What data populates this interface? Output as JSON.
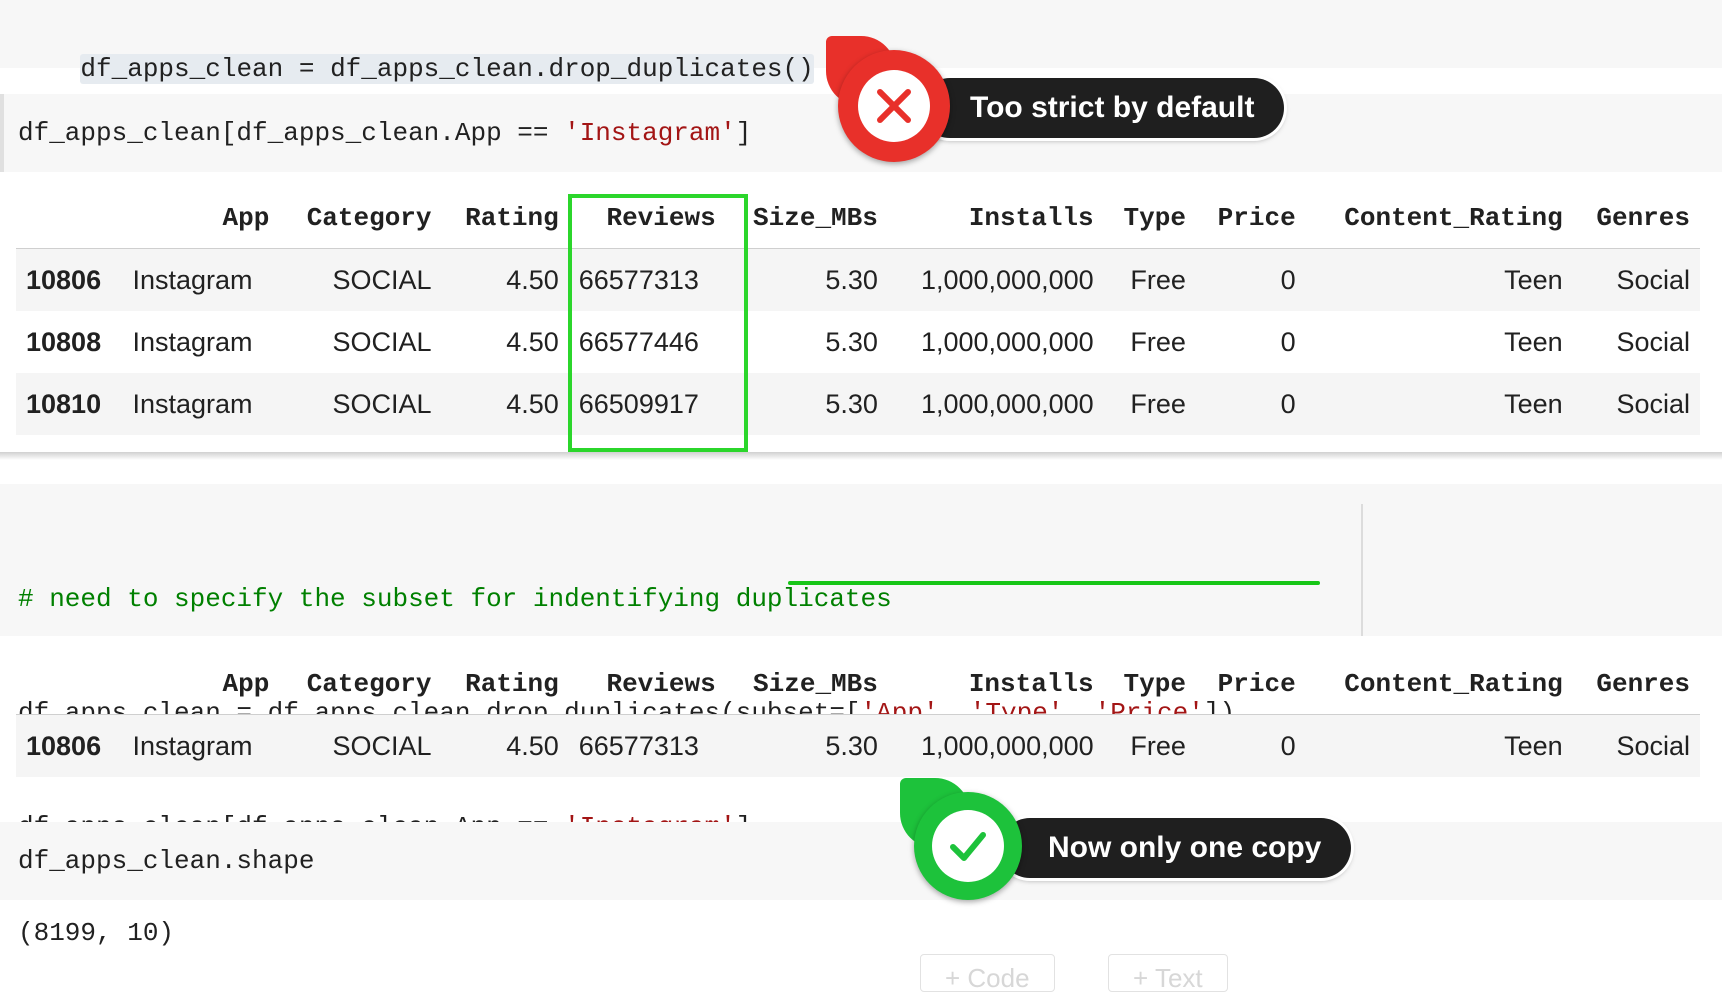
{
  "cells": {
    "c1": {
      "code": "df_apps_clean = df_apps_clean.drop_duplicates()"
    },
    "c2": {
      "code_prefix": "df_apps_clean[df_apps_clean.App == ",
      "code_string": "'Instagram'",
      "code_suffix": "]"
    },
    "c3": {
      "comment": "# need to specify the subset for indentifying duplicates",
      "line2_prefix": "df_apps_clean = df_apps_clean.drop_duplicates(",
      "line2_kw": "subset=[",
      "line2_s1": "'App'",
      "line2_sep1": ", ",
      "line2_s2": "'Type'",
      "line2_sep2": ", ",
      "line2_s3": "'Price'",
      "line2_suffix": "])",
      "line3_prefix": "df_apps_clean[df_apps_clean.App == ",
      "line3_string": "'Instagram'",
      "line3_suffix": "]"
    },
    "c4": {
      "code": "df_apps_clean.shape",
      "output": "(8199, 10)"
    }
  },
  "table_columns": [
    "App",
    "Category",
    "Rating",
    "Reviews",
    "Size_MBs",
    "Installs",
    "Type",
    "Price",
    "Content_Rating",
    "Genres"
  ],
  "table1_rows": [
    {
      "index": "10806",
      "App": "Instagram",
      "Category": "SOCIAL",
      "Rating": "4.50",
      "Reviews": "66577313",
      "Size_MBs": "5.30",
      "Installs": "1,000,000,000",
      "Type": "Free",
      "Price": "0",
      "Content_Rating": "Teen",
      "Genres": "Social"
    },
    {
      "index": "10808",
      "App": "Instagram",
      "Category": "SOCIAL",
      "Rating": "4.50",
      "Reviews": "66577446",
      "Size_MBs": "5.30",
      "Installs": "1,000,000,000",
      "Type": "Free",
      "Price": "0",
      "Content_Rating": "Teen",
      "Genres": "Social"
    },
    {
      "index": "10810",
      "App": "Instagram",
      "Category": "SOCIAL",
      "Rating": "4.50",
      "Reviews": "66509917",
      "Size_MBs": "5.30",
      "Installs": "1,000,000,000",
      "Type": "Free",
      "Price": "0",
      "Content_Rating": "Teen",
      "Genres": "Social"
    }
  ],
  "table2_rows": [
    {
      "index": "10806",
      "App": "Instagram",
      "Category": "SOCIAL",
      "Rating": "4.50",
      "Reviews": "66577313",
      "Size_MBs": "5.30",
      "Installs": "1,000,000,000",
      "Type": "Free",
      "Price": "0",
      "Content_Rating": "Teen",
      "Genres": "Social"
    }
  ],
  "annotations": {
    "bad": {
      "label": "Too strict by default",
      "icon": "x-icon",
      "color": "#e8302a"
    },
    "good": {
      "label": "Now only one copy",
      "icon": "check-icon",
      "color": "#1dc23b"
    }
  },
  "toolbar": {
    "code_label": "+ Code",
    "text_label": "+ Text"
  }
}
